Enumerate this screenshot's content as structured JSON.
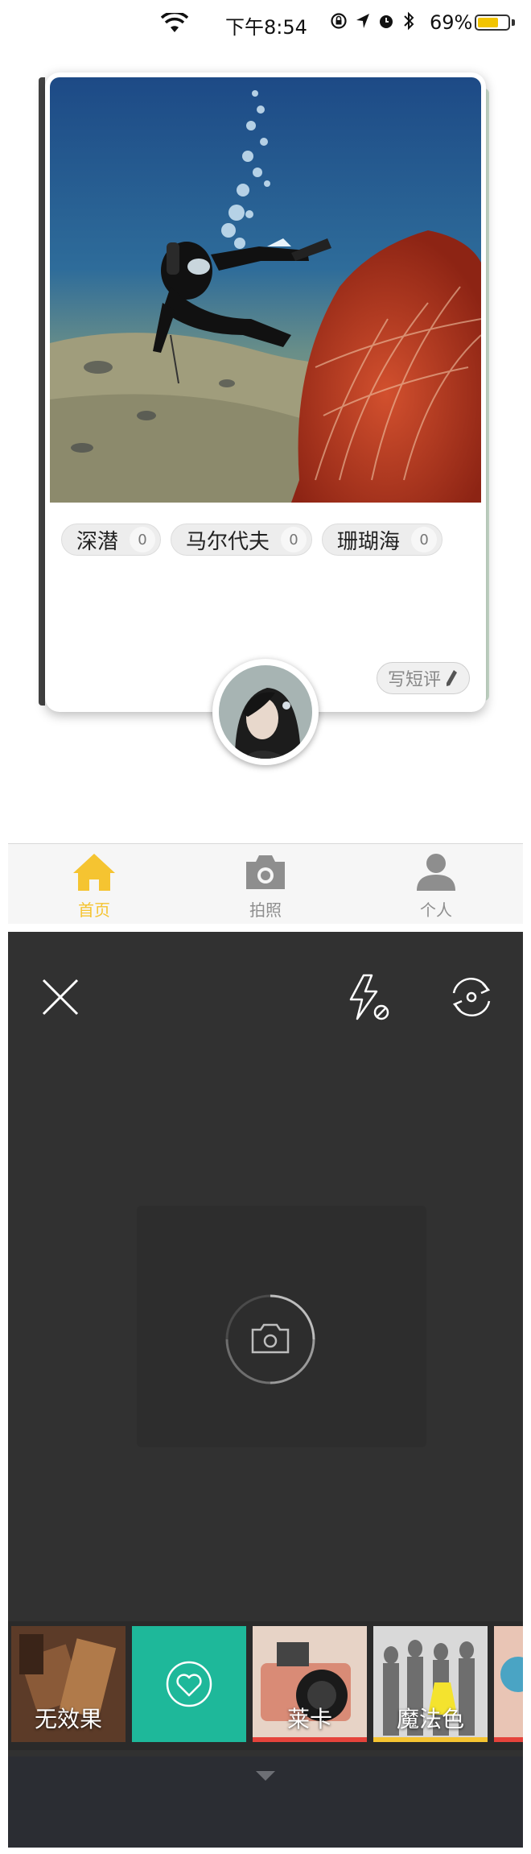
{
  "status_bar": {
    "time": "下午8:54",
    "battery_percent": "69%",
    "battery_level": 0.69,
    "icons": [
      "wifi-icon",
      "rotation-lock-icon",
      "location-arrow-icon",
      "alarm-icon",
      "bluetooth-icon",
      "battery-icon"
    ]
  },
  "card": {
    "tags": [
      {
        "label": "深潜",
        "count": "0"
      },
      {
        "label": "马尔代夫",
        "count": "0"
      },
      {
        "label": "珊瑚海",
        "count": "0"
      }
    ],
    "review_button": "写短评",
    "photo_icon": "scuba-diver-coral-photo",
    "avatar_icon": "user-avatar"
  },
  "tabbar": {
    "tabs": [
      {
        "label": "首页",
        "icon": "home-icon",
        "active": true
      },
      {
        "label": "拍照",
        "icon": "camera-icon",
        "active": false
      },
      {
        "label": "个人",
        "icon": "person-icon",
        "active": false
      }
    ],
    "active_color": "#f5c431",
    "inactive_color": "#8e8e8e"
  },
  "camera": {
    "icons": [
      "close-icon",
      "flash-off-icon",
      "switch-camera-icon",
      "shutter-icon",
      "chevron-down-icon"
    ],
    "filters": [
      {
        "label": "无效果",
        "bar_color": ""
      },
      {
        "label": "",
        "icon": "heart-icon",
        "bar_color": ""
      },
      {
        "label": "莱卡",
        "bar_color": "#e5433b"
      },
      {
        "label": "魔法色",
        "bar_color": "#f5c431"
      },
      {
        "label": "",
        "bar_color": "#e5433b"
      }
    ],
    "accent_teal": "#1eb89a"
  }
}
